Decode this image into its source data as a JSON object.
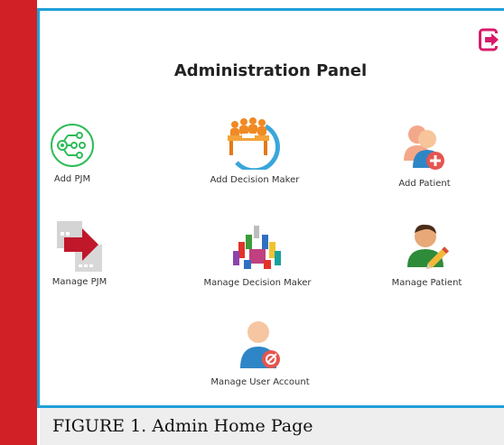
{
  "panel": {
    "title": "Administration Panel",
    "logout_icon": "logout-icon"
  },
  "tiles": [
    {
      "label": "Add PJM",
      "icon": "pjm-network-icon"
    },
    {
      "label": "Add Decision Maker",
      "icon": "team-meeting-icon"
    },
    {
      "label": "Add Patient",
      "icon": "add-user-icon"
    },
    {
      "label": "Manage PJM",
      "icon": "transfer-arrow-icon"
    },
    {
      "label": "Manage Decision Maker",
      "icon": "people-group-icon"
    },
    {
      "label": "Manage Patient",
      "icon": "user-edit-icon"
    },
    {
      "label": "Manage User Account",
      "icon": "user-settings-icon"
    }
  ],
  "caption": "FIGURE 1. Admin Home Page",
  "colors": {
    "accent_red": "#d22027",
    "accent_blue": "#1fa0d8",
    "logout_magenta": "#d81b6a"
  }
}
